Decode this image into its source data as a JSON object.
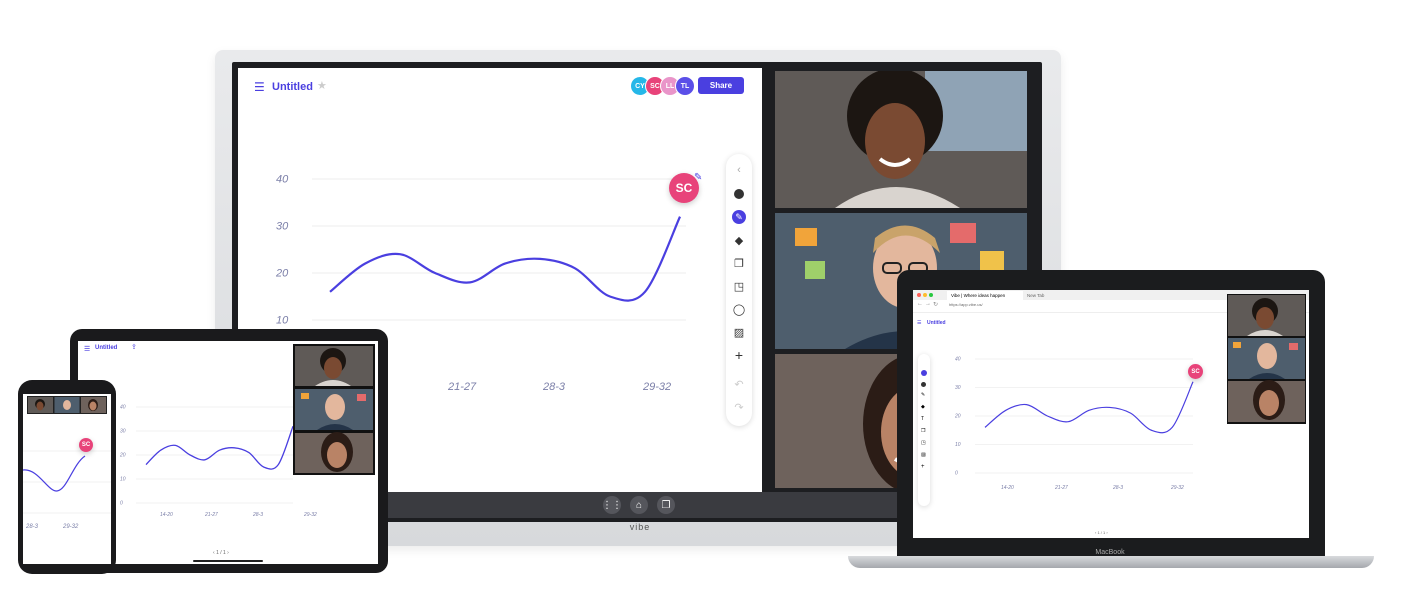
{
  "tv": {
    "brand": "vibe",
    "doc_title": "Untitled",
    "share_label": "Share",
    "collaborators": [
      {
        "initials": "CY",
        "color": "#25b7e8"
      },
      {
        "initials": "SC",
        "color": "#e8437a"
      },
      {
        "initials": "LL",
        "color": "#e995c9"
      },
      {
        "initials": "TL",
        "color": "#5b4fe8"
      }
    ],
    "cursor_user": "SC",
    "nav_icons": [
      "apps-icon",
      "home-icon",
      "window-icon"
    ]
  },
  "chart_data": {
    "type": "line",
    "y_ticks": [
      "40",
      "30",
      "20",
      "10"
    ],
    "x_ticks": [
      "21-27",
      "28-3",
      "29-32"
    ],
    "y_range": [
      10,
      40
    ],
    "grid": true,
    "series": [
      {
        "x": [
          0,
          1,
          2,
          3,
          4,
          5,
          6,
          7,
          8,
          9,
          10
        ],
        "values": [
          16,
          22,
          24,
          20,
          18,
          22,
          23,
          21,
          15,
          16,
          32
        ]
      }
    ]
  },
  "tablet": {
    "doc_title": "Untitled",
    "y_ticks": [
      "40",
      "30",
      "20",
      "10",
      "0"
    ],
    "x_ticks": [
      "14-20",
      "21-27",
      "28-3",
      "29-32"
    ],
    "page_label": "1 / 1"
  },
  "phone": {
    "x_ticks": [
      "28-3",
      "29-32"
    ],
    "cursor_user": "SC"
  },
  "laptop": {
    "brand": "MacBook",
    "tab1": "Vibe | Where ideas happen",
    "tab2": "New Tab",
    "url": "https://app.vibe.us/",
    "doc_title": "Untitled",
    "y_ticks": [
      "40",
      "30",
      "20",
      "10",
      "0"
    ],
    "x_ticks": [
      "14-20",
      "21-27",
      "28-3",
      "29-32"
    ],
    "page_label": "1 / 1",
    "cursor_user": "SC"
  },
  "colors": {
    "accent": "#4a3fe0",
    "cursor": "#e8437a"
  }
}
